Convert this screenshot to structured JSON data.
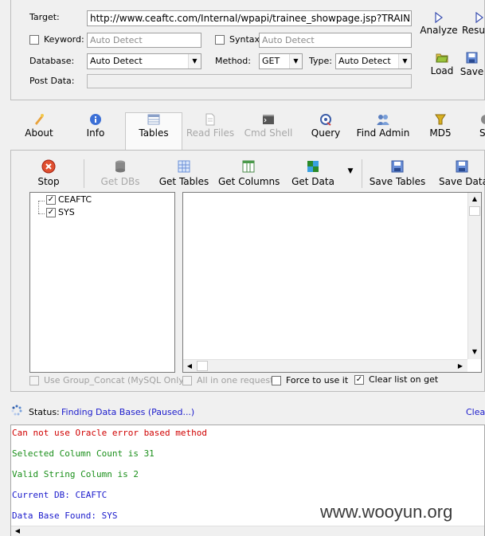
{
  "form": {
    "target_label": "Target:",
    "target_value": "http://www.ceaftc.com/Internal/wpapi/trainee_showpage.jsp?TRAINEE",
    "keyword_label": "Keyword:",
    "keyword_placeholder": "Auto Detect",
    "syntax_label": "Syntax:",
    "syntax_placeholder": "Auto Detect",
    "database_label": "Database:",
    "database_value": "Auto Detect",
    "method_label": "Method:",
    "method_value": "GET",
    "type_label": "Type:",
    "type_value": "Auto Detect",
    "postdata_label": "Post Data:"
  },
  "actions": {
    "analyze": "Analyze",
    "result": "Resu",
    "load": "Load",
    "save": "Save"
  },
  "tabs": [
    {
      "label": "About",
      "icon": "about-icon",
      "color": "#e9a23b"
    },
    {
      "label": "Info",
      "icon": "info-icon",
      "color": "#3b6fd6"
    },
    {
      "label": "Tables",
      "icon": "tables-icon",
      "color": "#8aa0c8"
    },
    {
      "label": "Read Files",
      "icon": "read-files-icon",
      "color": "#c0c0c0"
    },
    {
      "label": "Cmd Shell",
      "icon": "cmd-shell-icon",
      "color": "#555555"
    },
    {
      "label": "Query",
      "icon": "query-icon",
      "color": "#3d5ea8"
    },
    {
      "label": "Find Admin",
      "icon": "find-admin-icon",
      "color": "#5a7fc0"
    },
    {
      "label": "MD5",
      "icon": "md5-icon",
      "color": "#d8b020"
    },
    {
      "label": "S",
      "icon": "settings-icon",
      "color": "#888888"
    }
  ],
  "toolbar": {
    "stop": "Stop",
    "get_dbs": "Get DBs",
    "get_tables": "Get Tables",
    "get_columns": "Get Columns",
    "get_data": "Get Data",
    "save_tables": "Save Tables",
    "save_data": "Save Data"
  },
  "tree": {
    "items": [
      "CEAFTC",
      "SYS"
    ]
  },
  "options": {
    "group_concat": "Use Group_Concat (MySQL Only)",
    "all_in_one": "All in one request.",
    "force": "Force to use it",
    "clear_list": "Clear list on get"
  },
  "status": {
    "label": "Status:",
    "text": "Finding Data Bases (Paused...)",
    "clear": "Clear"
  },
  "log": [
    {
      "text": "Can not use Oracle error based method",
      "color": "#d00000"
    },
    {
      "text": "Selected Column Count is 31",
      "color": "#1a8f1a"
    },
    {
      "text": "Valid String Column is 2",
      "color": "#1a8f1a"
    },
    {
      "text": "Current DB: CEAFTC",
      "color": "#1a1acc"
    },
    {
      "text": "Data Base Found: SYS",
      "color": "#1a1acc"
    }
  ],
  "watermark": "www.wooyun.org"
}
